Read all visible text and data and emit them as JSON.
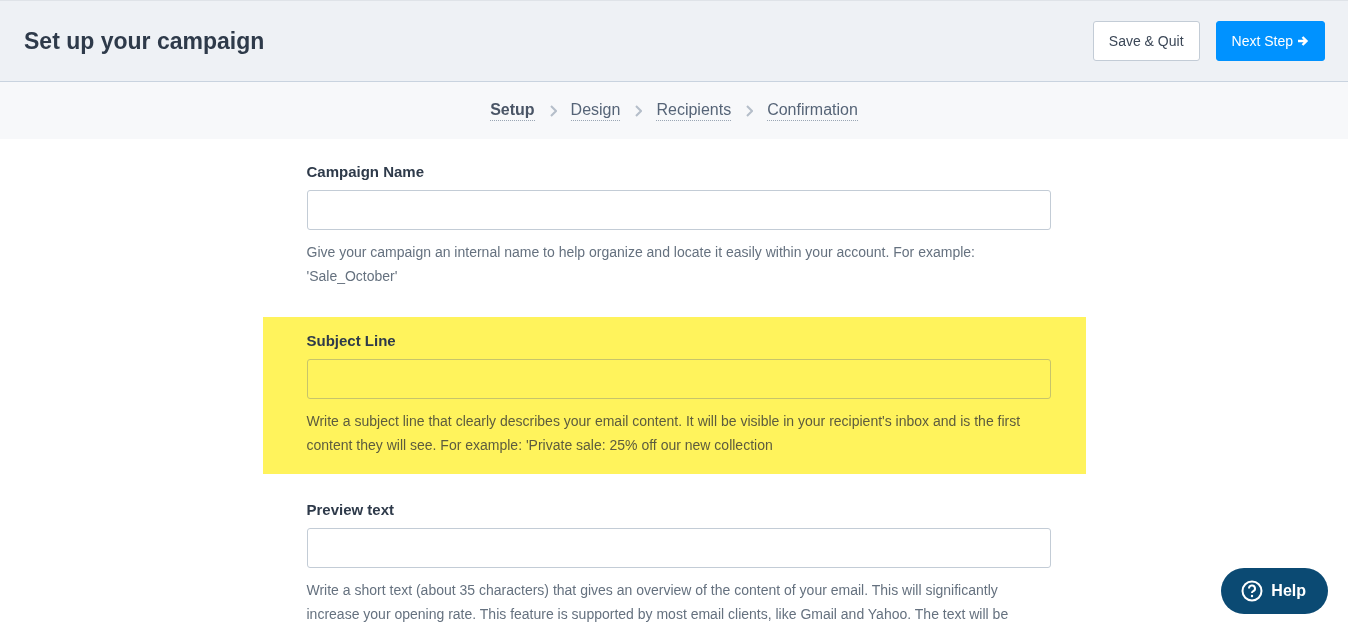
{
  "header": {
    "title": "Set up your campaign",
    "buttons": [
      {
        "label": "Save & Quit",
        "kind": "secondary"
      },
      {
        "label": "Next Step",
        "kind": "primary"
      }
    ]
  },
  "steps": [
    {
      "label": "Setup",
      "selected": true
    },
    {
      "label": "Design",
      "selected": false
    },
    {
      "label": "Recipients",
      "selected": false
    },
    {
      "label": "Confirmation",
      "selected": false
    }
  ],
  "fields": [
    {
      "label": "Campaign Name",
      "highlighted": false,
      "description": "Give your campaign an internal name to help organize and locate it easily within your account. For example: 'Sale_October'"
    },
    {
      "label": "Subject Line",
      "highlighted": true,
      "description": "Write a subject line that clearly describes your email content. It will be visible in your recipient's inbox and is the first content they will see. For example: 'Private sale: 25% off our new collection"
    },
    {
      "label": "Preview text",
      "highlighted": false,
      "description": "Write a short text (about 35 characters) that gives an overview of the content of your email. This will significantly increase your opening rate. This feature is supported by most email clients, like Gmail and Yahoo. The text will be"
    }
  ],
  "help_button": {
    "label": "Help"
  }
}
